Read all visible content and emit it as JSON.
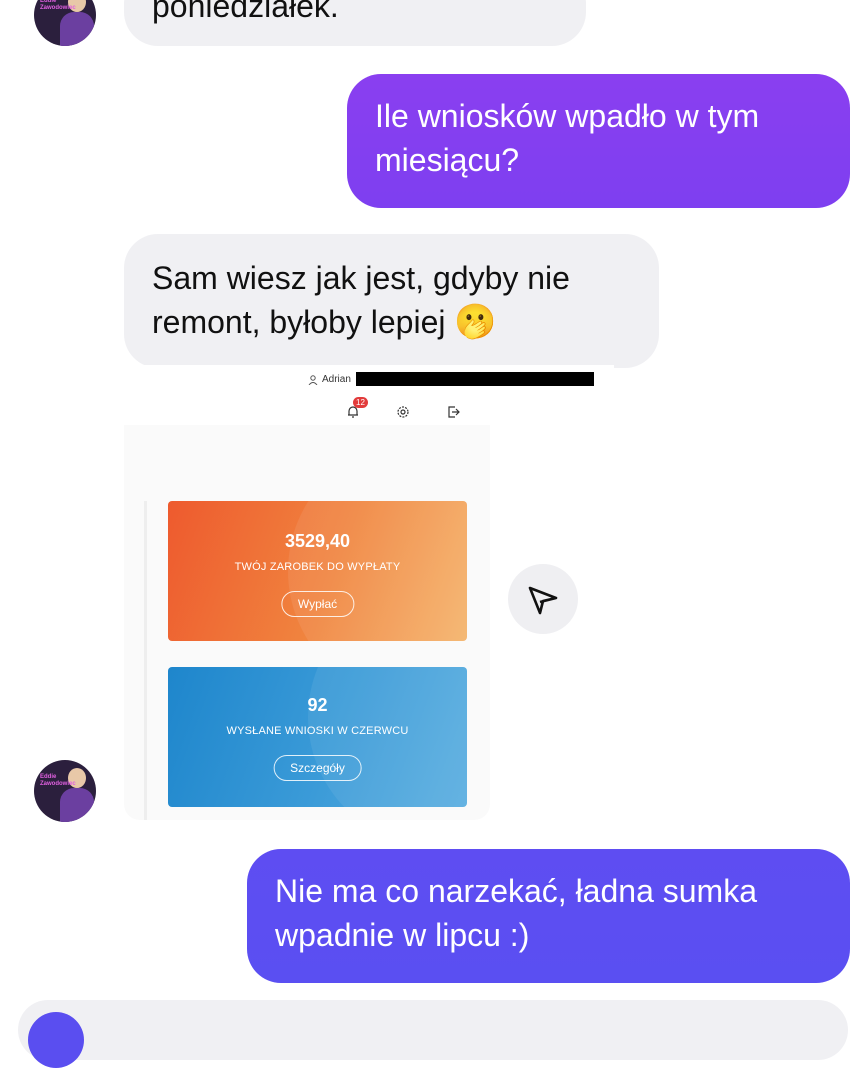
{
  "messages": {
    "m1_text": "poniedziałek.",
    "m2_text": "Ile wniosków wpadło w tym miesiącu?",
    "m3_text": "Sam wiesz jak jest, gdyby nie remont, byłoby lepiej",
    "m3_emoji": "🫢",
    "m5_text": "Nie ma co narzekać, ładna sumka wpadnie w lipcu :)"
  },
  "avatar": {
    "text": "Eddie Zawodowiec"
  },
  "screenshot": {
    "user_name": "Adrian",
    "notification_count": "12",
    "earnings_card": {
      "value": "3529,40",
      "label": "TWÓJ ZAROBEK DO WYPŁATY",
      "button": "Wypłać"
    },
    "applications_card": {
      "value": "92",
      "label": "WYSŁANE WNIOSKI W CZERWCU",
      "button": "Szczegóły"
    }
  },
  "colors": {
    "incoming_bubble": "#f0f0f3",
    "outgoing_top": "#8a3ff0",
    "outgoing_bottom": "#5c4ef2",
    "earnings_card_start": "#ee5a2e",
    "earnings_card_end": "#f4b36a",
    "applications_card_start": "#1e86cc",
    "applications_card_end": "#5aaee0"
  },
  "icons": {
    "share": "paper-plane-icon",
    "bell": "bell-icon",
    "settings": "gear-icon",
    "logout": "logout-icon",
    "user": "user-icon"
  }
}
